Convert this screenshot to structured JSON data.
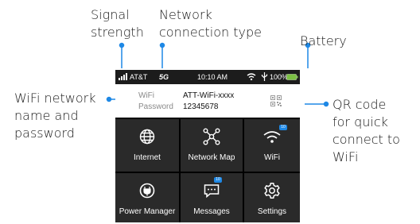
{
  "callouts": {
    "signal_strength": [
      "Signal",
      "strength"
    ],
    "network_type": [
      "Network",
      "connection type"
    ],
    "battery": [
      "Battery"
    ],
    "wifi_name": [
      "WiFi network",
      "name and",
      "password"
    ],
    "qr_code": [
      "QR code",
      "for quick",
      "connect  to",
      "WiFi"
    ]
  },
  "status_bar": {
    "carrier": "AT&T",
    "network": "5G",
    "time": "10:10 AM",
    "battery_percent": "100%"
  },
  "wifi": {
    "name_label": "WiFi",
    "name_value": "ATT-WiFi-xxxx",
    "password_label": "Password",
    "password_value": "12345678"
  },
  "tiles": {
    "internet": "Internet",
    "network_map": "Network Map",
    "wifi": "WiFi",
    "power_manager": "Power Manager",
    "messages": "Messages",
    "settings": "Settings"
  },
  "badges": {
    "wifi": "10",
    "messages": "10"
  },
  "colors": {
    "accent": "#1e88e5",
    "battery": "#7bc043",
    "tile": "#2a2a2a",
    "background": "#000000"
  },
  "icons": [
    "signal-bars-icon",
    "wifi-icon",
    "usb-icon",
    "battery-icon",
    "qr-code-icon",
    "globe-icon",
    "network-map-icon",
    "wifi-icon",
    "power-icon",
    "message-icon",
    "gear-icon"
  ]
}
